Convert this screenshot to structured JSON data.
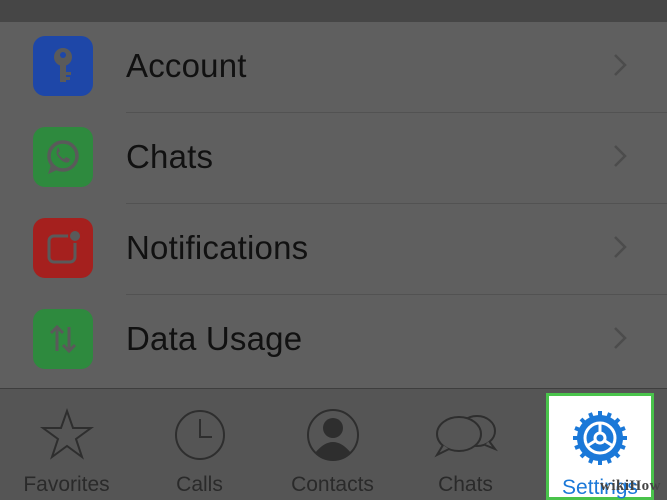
{
  "colors": {
    "account_icon": "#1e47a8",
    "chats_icon": "#2e8a3e",
    "notifications_icon": "#a5201e",
    "data_usage_icon": "#2e8a3e",
    "active_tab_accent": "#1a78d8",
    "highlight_border": "#49c34b"
  },
  "settings_list": {
    "items": [
      {
        "label": "Account",
        "icon": "key-icon"
      },
      {
        "label": "Chats",
        "icon": "whatsapp-icon"
      },
      {
        "label": "Notifications",
        "icon": "notification-badge-icon"
      },
      {
        "label": "Data Usage",
        "icon": "up-down-arrows-icon"
      }
    ]
  },
  "tab_bar": {
    "tabs": [
      {
        "label": "Favorites",
        "icon": "star-icon",
        "active": false
      },
      {
        "label": "Calls",
        "icon": "clock-icon",
        "active": false
      },
      {
        "label": "Contacts",
        "icon": "contact-silhouette-icon",
        "active": false
      },
      {
        "label": "Chats",
        "icon": "chat-bubbles-icon",
        "active": false
      },
      {
        "label": "Settings",
        "icon": "gear-icon",
        "active": true
      }
    ]
  },
  "watermark": "wikiHow"
}
